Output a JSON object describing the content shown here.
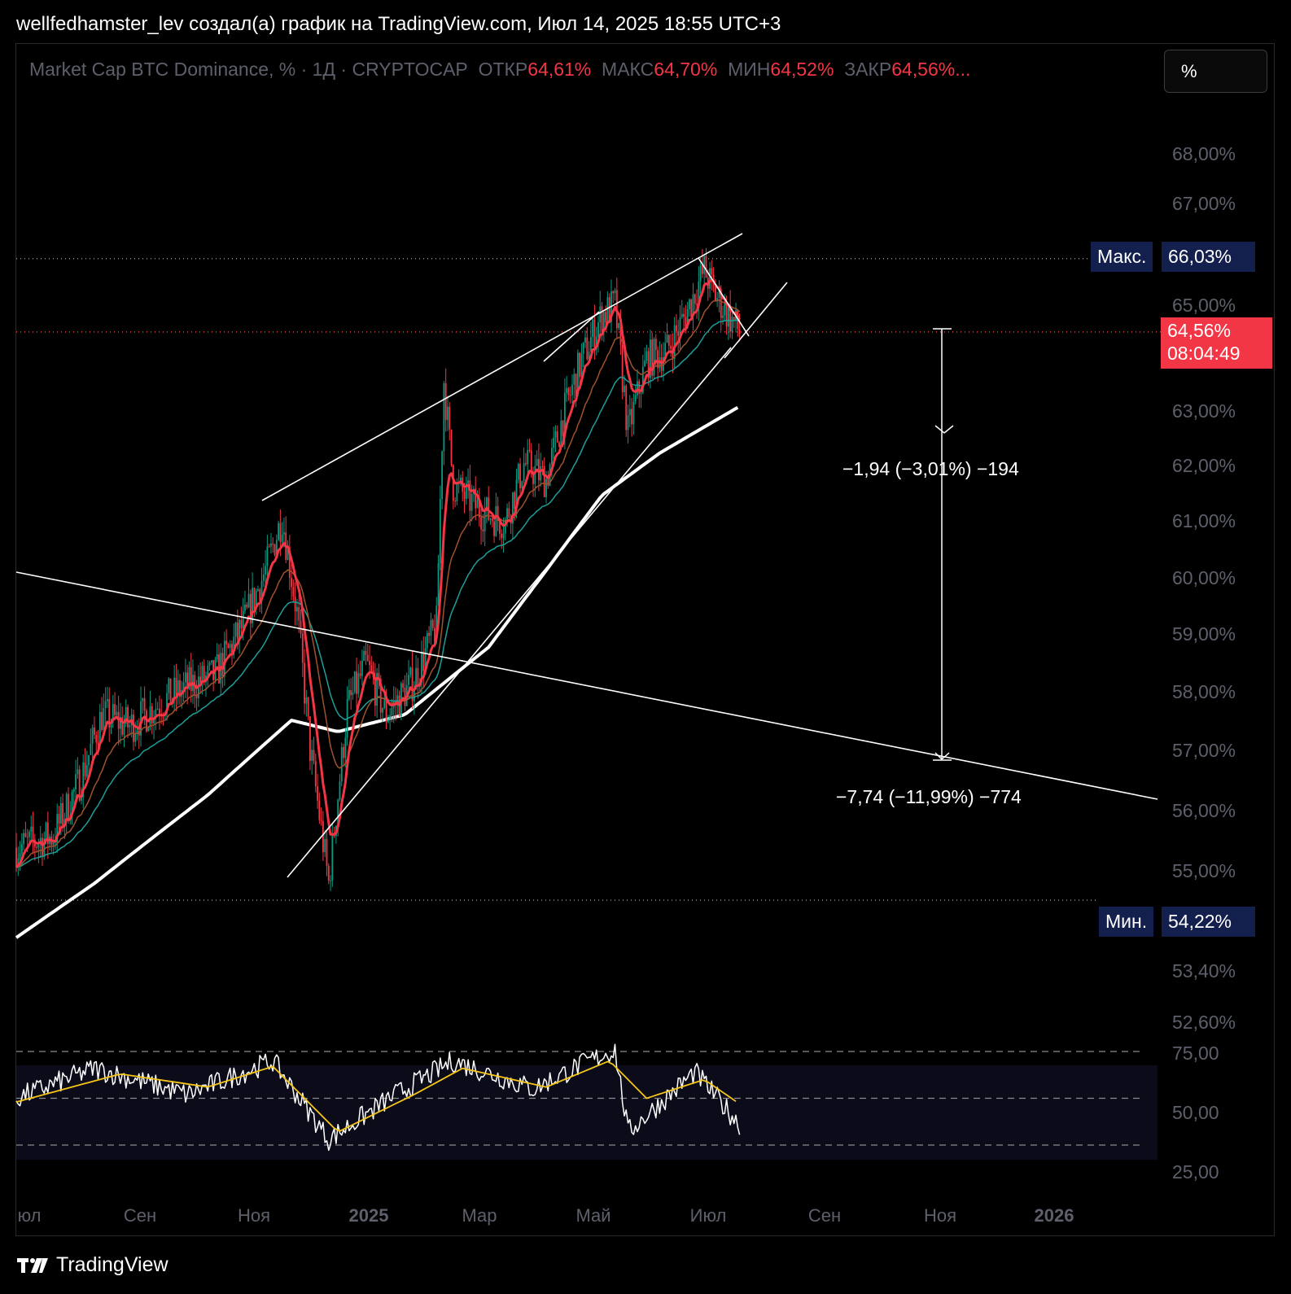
{
  "header": "wellfedhamster_lev создал(а) график на TradingView.com, Июл 14, 2025 18:55 UTC+3",
  "legend": {
    "symbol": "Market Cap BTC Dominance, % · 1Д · CRYPTOCAP",
    "open_label": "ОТКР",
    "open": "64,61%",
    "high_label": "МАКС",
    "high": "64,70%",
    "low_label": "МИН",
    "low": "64,52%",
    "close_label": "ЗАКР",
    "close": "64,56%..."
  },
  "scale_button": "%",
  "price_axis": [
    "68,00%",
    "67,00%",
    "65,00%",
    "63,00%",
    "62,00%",
    "61,00%",
    "60,00%",
    "59,00%",
    "58,00%",
    "57,00%",
    "56,00%",
    "55,00%",
    "53,40%",
    "52,60%"
  ],
  "rsi_axis": [
    "75,00",
    "50,00",
    "25,00"
  ],
  "time_axis": [
    "юл",
    "Сен",
    "Ноя",
    "2025",
    "Мар",
    "Май",
    "Июл",
    "Сен",
    "Ноя",
    "2026"
  ],
  "tags": {
    "max_label": "Макс.",
    "max_value": "66,03%",
    "min_label": "Мин.",
    "min_value": "54,22%",
    "current_value": "64,56%",
    "countdown": "08:04:49"
  },
  "measurements": {
    "short": "−1,94 (−3,01%) −194",
    "long": "−7,74 (−11,99%) −774"
  },
  "footer": {
    "brand": "TradingView"
  },
  "colors": {
    "up": "#089981",
    "down": "#f23645",
    "ema_fast": "#f23645",
    "ema_mid": "#a0522d",
    "ema_slow": "#1e9e98",
    "ema_long": "#ffffff",
    "rsi": "#ffffff",
    "rsi_ma": "#f5c518",
    "tag_navy": "#131f4d"
  },
  "chart_data": {
    "type": "candlestick",
    "title": "Market Cap BTC Dominance, %",
    "timeframe": "1Д",
    "yscale": "log",
    "ylim": [
      52.2,
      68.6
    ],
    "xlim": [
      "2024-06-20",
      "2026-02-15"
    ],
    "ohlc_last": {
      "open": 64.61,
      "high": 64.7,
      "low": 64.52,
      "close": 64.56
    },
    "price_path": [
      [
        "2024-06-20",
        55.1
      ],
      [
        "2024-07-10",
        55.3
      ],
      [
        "2024-07-25",
        56.3
      ],
      [
        "2024-08-05",
        57.4
      ],
      [
        "2024-08-20",
        57.2
      ],
      [
        "2024-09-05",
        57.6
      ],
      [
        "2024-09-20",
        57.9
      ],
      [
        "2024-10-05",
        58.1
      ],
      [
        "2024-10-20",
        59.0
      ],
      [
        "2024-11-01",
        60.0
      ],
      [
        "2024-11-10",
        61.0
      ],
      [
        "2024-11-18",
        59.2
      ],
      [
        "2024-11-25",
        56.8
      ],
      [
        "2024-12-05",
        54.5
      ],
      [
        "2024-12-15",
        57.5
      ],
      [
        "2024-12-25",
        58.3
      ],
      [
        "2025-01-05",
        57.4
      ],
      [
        "2025-01-20",
        58.0
      ],
      [
        "2025-02-01",
        59.0
      ],
      [
        "2025-02-05",
        63.6
      ],
      [
        "2025-02-10",
        61.6
      ],
      [
        "2025-02-25",
        61.1
      ],
      [
        "2025-03-10",
        60.9
      ],
      [
        "2025-03-20",
        62.0
      ],
      [
        "2025-04-01",
        61.7
      ],
      [
        "2025-04-10",
        62.9
      ],
      [
        "2025-04-20",
        64.0
      ],
      [
        "2025-05-01",
        64.9
      ],
      [
        "2025-05-08",
        65.1
      ],
      [
        "2025-05-15",
        62.6
      ],
      [
        "2025-05-25",
        64.0
      ],
      [
        "2025-06-05",
        64.2
      ],
      [
        "2025-06-15",
        64.9
      ],
      [
        "2025-06-25",
        65.8
      ],
      [
        "2025-07-01",
        65.3
      ],
      [
        "2025-07-08",
        64.9
      ],
      [
        "2025-07-14",
        64.56
      ]
    ],
    "ema_long_path": [
      [
        "2024-06-20",
        53.6
      ],
      [
        "2024-08-01",
        54.5
      ],
      [
        "2024-10-01",
        56.0
      ],
      [
        "2024-11-15",
        57.3
      ],
      [
        "2024-12-10",
        57.1
      ],
      [
        "2025-01-15",
        57.4
      ],
      [
        "2025-03-01",
        58.6
      ],
      [
        "2025-04-01",
        60.0
      ],
      [
        "2025-05-01",
        61.4
      ],
      [
        "2025-06-01",
        62.2
      ],
      [
        "2025-07-14",
        63.1
      ]
    ],
    "rsi": {
      "levels": [
        75,
        50,
        25
      ],
      "path": [
        [
          "2024-06-20",
          50
        ],
        [
          "2024-08-01",
          66
        ],
        [
          "2024-09-20",
          52
        ],
        [
          "2024-11-05",
          70
        ],
        [
          "2024-12-05",
          28
        ],
        [
          "2025-01-10",
          52
        ],
        [
          "2025-02-10",
          70
        ],
        [
          "2025-03-25",
          55
        ],
        [
          "2025-04-20",
          68
        ],
        [
          "2025-05-08",
          76
        ],
        [
          "2025-05-15",
          32
        ],
        [
          "2025-06-20",
          64
        ],
        [
          "2025-07-14",
          36
        ]
      ],
      "ma_path": [
        [
          "2024-06-20",
          48
        ],
        [
          "2024-08-15",
          63
        ],
        [
          "2024-10-01",
          56
        ],
        [
          "2024-11-05",
          67
        ],
        [
          "2024-12-10",
          32
        ],
        [
          "2025-01-20",
          52
        ],
        [
          "2025-02-15",
          66
        ],
        [
          "2025-04-01",
          56
        ],
        [
          "2025-05-05",
          70
        ],
        [
          "2025-05-25",
          50
        ],
        [
          "2025-06-25",
          60
        ],
        [
          "2025-07-14",
          47
        ]
      ]
    },
    "levels": {
      "max": 66.03,
      "min": 54.22,
      "current": 64.56
    }
  }
}
